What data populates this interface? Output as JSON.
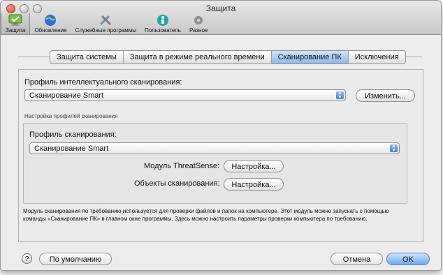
{
  "window": {
    "title": "Защита"
  },
  "toolbar": {
    "items": [
      {
        "label": "Защита",
        "icon": "monitor-check-icon",
        "selected": true
      },
      {
        "label": "Обновление",
        "icon": "globe-icon",
        "selected": false
      },
      {
        "label": "Служебные программы",
        "icon": "tools-icon",
        "selected": false
      },
      {
        "label": "Пользователь",
        "icon": "user-icon",
        "selected": false
      },
      {
        "label": "Разное",
        "icon": "gear-icon",
        "selected": false
      }
    ]
  },
  "tabs": [
    {
      "label": "Защита системы",
      "active": false
    },
    {
      "label": "Защита в режиме реального времени",
      "active": false
    },
    {
      "label": "Сканирование ПК",
      "active": true
    },
    {
      "label": "Исключения",
      "active": false
    }
  ],
  "main": {
    "profile_label": "Профиль интеллектуального сканирования:",
    "profile_value": "Сканирование Smart",
    "change_button": "Изменить...",
    "group_title": "Настройка профилей сканирования",
    "scan_profile_label": "Профиль сканирования:",
    "scan_profile_value": "Сканирование Smart",
    "threatsense_label": "Модуль ThreatSense:",
    "threatsense_button": "Настройка...",
    "objects_label": "Объекты сканирования:",
    "objects_button": "Настройка...",
    "description": "Модуль сканирования по требованию используется для проверки файлов и папок на компьютере. Этот модуль можно запускать с помощью команды «Сканирование ПК» в главном окне программы. Здесь можно настроить параметры проверки компьютера по требованию."
  },
  "footer": {
    "help_label": "?",
    "defaults_button": "По умолчанию",
    "cancel_button": "Отмена",
    "ok_button": "OK"
  }
}
